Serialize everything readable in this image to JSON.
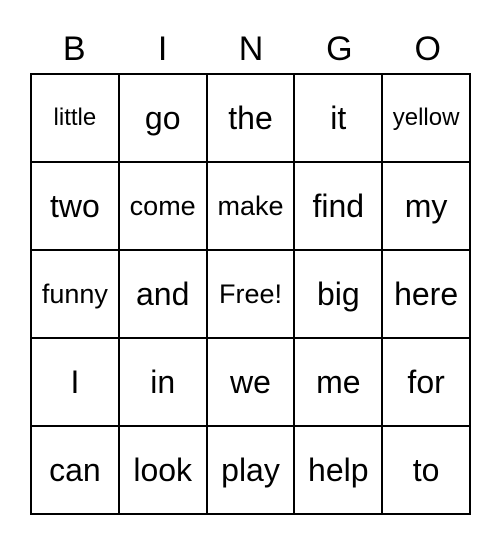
{
  "header": [
    "B",
    "I",
    "N",
    "G",
    "O"
  ],
  "rows": [
    [
      "little",
      "go",
      "the",
      "it",
      "yellow"
    ],
    [
      "two",
      "come",
      "make",
      "find",
      "my"
    ],
    [
      "funny",
      "and",
      "Free!",
      "big",
      "here"
    ],
    [
      "I",
      "in",
      "we",
      "me",
      "for"
    ],
    [
      "can",
      "look",
      "play",
      "help",
      "to"
    ]
  ]
}
